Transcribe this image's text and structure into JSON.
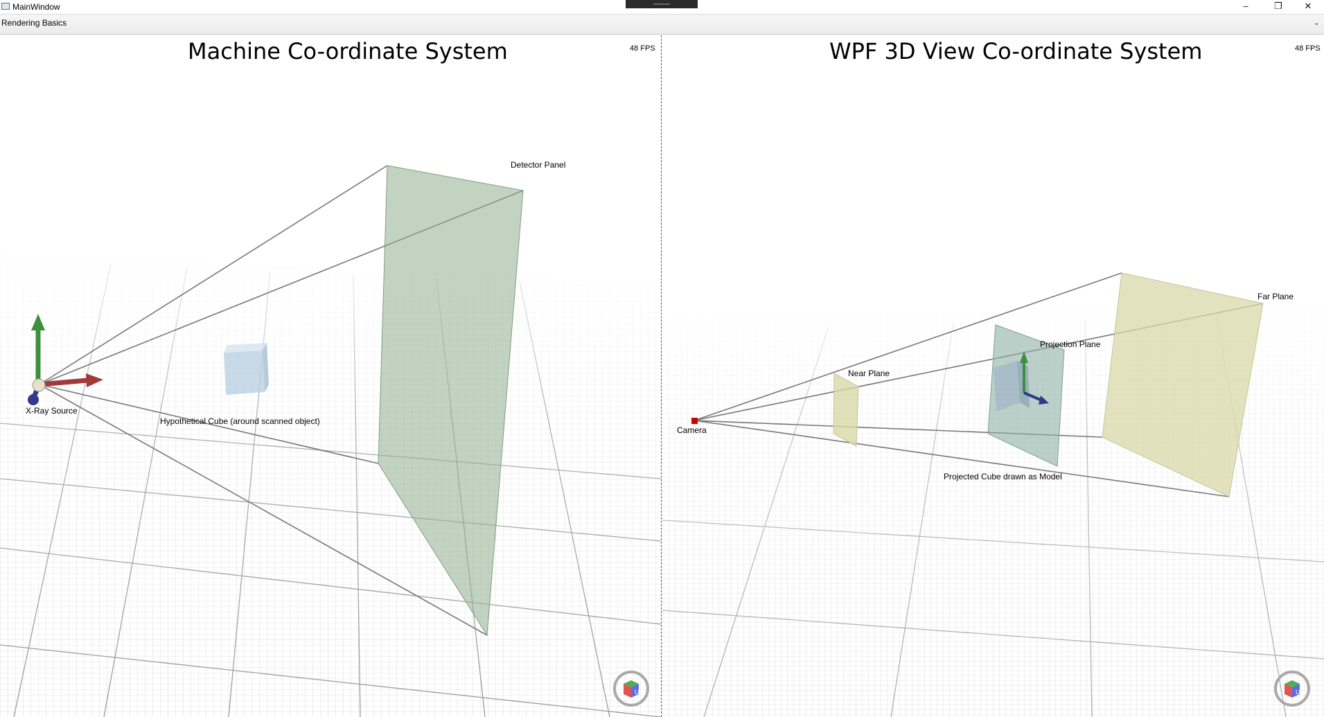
{
  "window": {
    "title": "MainWindow",
    "min_glyph": "–",
    "max_glyph": "❐",
    "close_glyph": "✕"
  },
  "expander": {
    "label": "Rendering Basics",
    "chevron": "⌄"
  },
  "left_viewport": {
    "title": "Machine Co-ordinate System",
    "fps": "48 FPS",
    "labels": {
      "detector": "Detector Panel",
      "source": "X-Ray Source",
      "cube": "Hypothetical Cube (around scanned object)"
    },
    "colors": {
      "detector": "#8fae8f",
      "cube": "#b6cde0",
      "axis_y": "#3e8e3e",
      "axis_x": "#a33a3a",
      "axis_z": "#2f3a8a"
    }
  },
  "right_viewport": {
    "title": "WPF 3D View Co-ordinate System",
    "fps": "48 FPS",
    "labels": {
      "far": "Far Plane",
      "projection": "Projection Plane",
      "near": "Near Plane",
      "camera": "Camera",
      "projected": "Projected Cube drawn as Model"
    },
    "colors": {
      "far": "#d8d8a8",
      "near": "#d8d8a8",
      "projection": "#8fb0a6",
      "camera": "#cc0000"
    }
  },
  "nav_cube_icon": "view-cube-icon"
}
